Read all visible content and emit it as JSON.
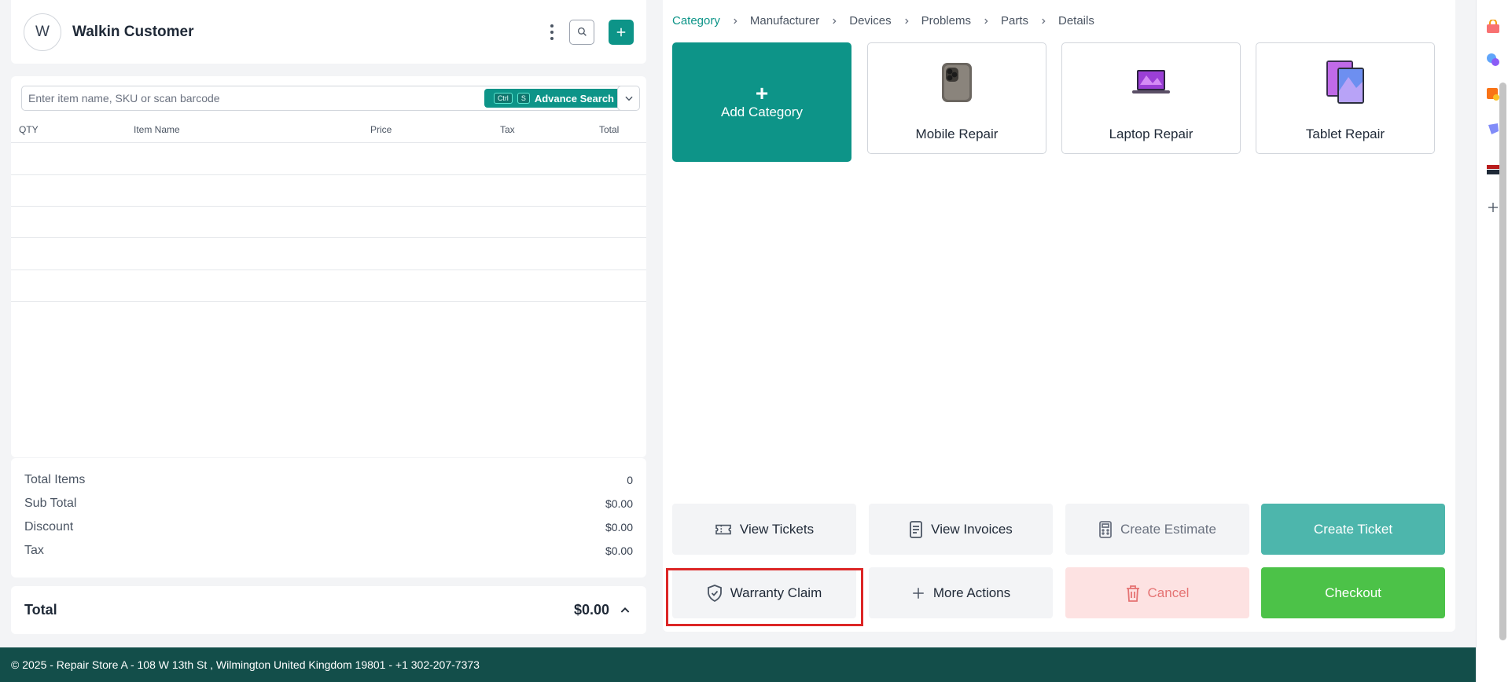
{
  "customer": {
    "initial": "W",
    "name": "Walkin Customer"
  },
  "search": {
    "placeholder": "Enter item name, SKU or scan barcode",
    "kbd_ctrl": "Ctrl",
    "kbd_key": "S",
    "advance_label": "Advance Search"
  },
  "table": {
    "headers": [
      "QTY",
      "Item Name",
      "Price",
      "Tax",
      "Total"
    ]
  },
  "totals": {
    "total_items_label": "Total Items",
    "total_items_value": "0",
    "subtotal_label": "Sub Total",
    "subtotal_value": "$0.00",
    "discount_label": "Discount",
    "discount_value": "$0.00",
    "tax_label": "Tax",
    "tax_value": "$0.00",
    "grand_label": "Total",
    "grand_value": "$0.00"
  },
  "breadcrumb": [
    "Category",
    "Manufacturer",
    "Devices",
    "Problems",
    "Parts",
    "Details"
  ],
  "tiles": {
    "add_plus": "+",
    "add_label": "Add Category",
    "items": [
      "Mobile Repair",
      "Laptop Repair",
      "Tablet Repair"
    ]
  },
  "actions": {
    "view_tickets": "View Tickets",
    "view_invoices": "View Invoices",
    "create_estimate": "Create Estimate",
    "create_ticket": "Create Ticket",
    "warranty_claim": "Warranty Claim",
    "more_actions": "More Actions",
    "cancel": "Cancel",
    "checkout": "Checkout"
  },
  "footer": {
    "text": "© 2025 - Repair Store A - 108 W 13th St , Wilmington United Kingdom 19801 - +1 302-207-7373"
  },
  "colors": {
    "accent": "#0d9488",
    "checkout": "#4cc248",
    "cancel_bg": "#fde2e2",
    "footer_bg": "#134e4a",
    "highlight": "#dc2626"
  }
}
